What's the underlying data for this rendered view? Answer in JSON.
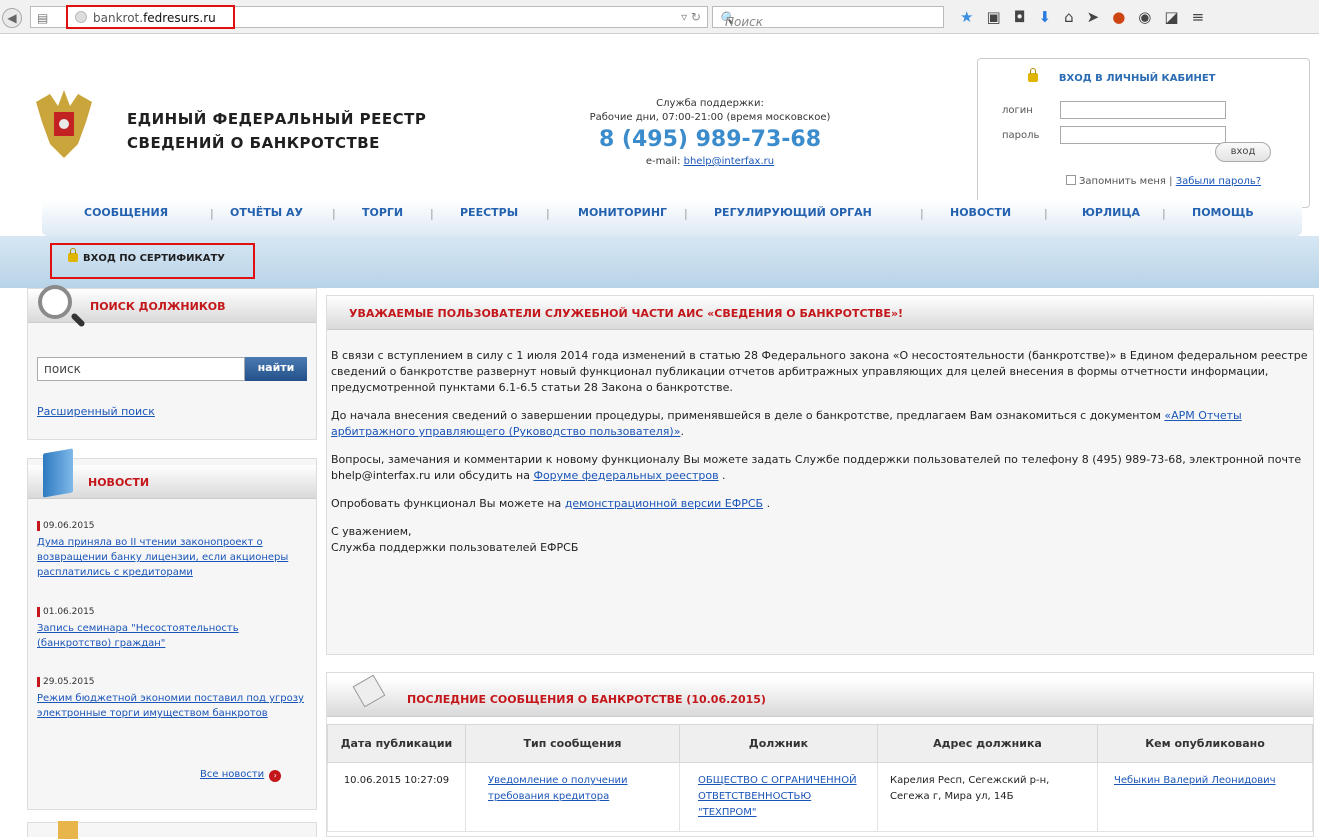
{
  "browser": {
    "url_prefix": "bankrot.",
    "url_domain": "fedresurs.ru",
    "search_placeholder": "Поиск",
    "toolbar_icons": [
      "star-icon",
      "clipboard-icon",
      "pocket-icon",
      "download-icon",
      "home-icon",
      "send-icon",
      "adblock-icon",
      "chat-icon",
      "resize-icon",
      "menu-icon"
    ]
  },
  "header": {
    "title_line1": "ЕДИНЫЙ ФЕДЕРАЛЬНЫЙ РЕЕСТР",
    "title_line2": "СВЕДЕНИЙ О БАНКРОТСТВЕ",
    "support_label": "Служба поддержки:",
    "support_hours": "Рабочие дни, 07:00-21:00 (время московское)",
    "support_phone": "8 (495) 989-73-68",
    "support_email_label": "e-mail: ",
    "support_email": "bhelp@interfax.ru"
  },
  "login": {
    "heading": "ВХОД В ЛИЧНЫЙ КАБИНЕТ",
    "login_label": "логин",
    "password_label": "пароль",
    "submit": "вход",
    "remember": "Запомнить меня",
    "separator": "|",
    "forgot": "Забыли пароль?"
  },
  "nav": [
    "СООБЩЕНИЯ",
    "ОТЧЁТЫ АУ",
    "ТОРГИ",
    "РЕЕСТРЫ",
    "МОНИТОРИНГ",
    "РЕГУЛИРУЮЩИЙ ОРГАН",
    "НОВОСТИ",
    "ЮРЛИЦА",
    "ПОМОЩЬ"
  ],
  "cert_login": "ВХОД ПО СЕРТИФИКАТУ",
  "search_panel": {
    "title": "ПОИСК ДОЛЖНИКОВ",
    "input_value": "поиск",
    "button": "найти",
    "advanced": "Расширенный поиск"
  },
  "news": {
    "title": "НОВОСТИ",
    "items": [
      {
        "date": "09.06.2015",
        "text": "Дума приняла во II чтении законопроект о возвращении банку лицензии, если акционеры расплатились с кредиторами"
      },
      {
        "date": "01.06.2015",
        "text": "Запись семинара \"Несостоятельность (банкротство) граждан\""
      },
      {
        "date": "29.05.2015",
        "text": "Режим бюджетной экономии поставил под угрозу электронные торги имуществом банкротов"
      }
    ],
    "all": "Все новости"
  },
  "notice": {
    "title": "УВАЖАЕМЫЕ ПОЛЬЗОВАТЕЛИ СЛУЖЕБНОЙ ЧАСТИ АИС «СВЕДЕНИЯ О БАНКРОТСТВЕ»!",
    "p1": "В связи с вступлением в силу с 1 июля 2014 года изменений в статью 28 Федерального закона «О несостоятельности (банкротстве)» в Едином федеральном реестре сведений о банкротстве развернут новый функционал публикации отчетов арбитражных управляющих для целей внесения в формы отчетности информации, предусмотренной пунктами 6.1-6.5 статьи 28 Закона о банкротстве.",
    "p2_text": "До начала внесения сведений о завершении процедуры, применявшейся в деле о банкротстве, предлагаем Вам ознакомиться с документом ",
    "p2_link": "«АРМ Отчеты арбитражного управляющего (Руководство пользователя)»",
    "p2_end": ".",
    "p3_text": "Вопросы, замечания и комментарии к новому функционалу Вы можете задать Службе поддержки пользователей по телефону 8 (495) 989-73-68, электронной почте bhelp@interfax.ru или обсудить на ",
    "p3_link": "Форуме федеральных реестров",
    "p3_end": " .",
    "p4_text": "Опробовать функционал Вы можете на ",
    "p4_link": "демонстрационной версии ЕФРСБ",
    "p4_end": " .",
    "sign1": "С уважением,",
    "sign2": "Служба поддержки пользователей ЕФРСБ"
  },
  "messages": {
    "title": "ПОСЛЕДНИЕ СООБЩЕНИЯ О БАНКРОТСТВЕ (10.06.2015)",
    "headers": [
      "Дата публикации",
      "Тип сообщения",
      "Должник",
      "Адрес должника",
      "Кем опубликовано"
    ],
    "rows": [
      {
        "date": "10.06.2015 10:27:09",
        "type": "Уведомление о получении требования кредитора",
        "debtor": "ОБЩЕСТВО С ОГРАНИЧЕННОЙ ОТВЕТСТВЕННОСТЬЮ \"ТЕХПРОМ\"",
        "address": "Карелия Респ, Сегежский р-н, Сегежа г, Мира ул, 14Б",
        "publisher": "Чебыкин Валерий Леонидович"
      }
    ]
  }
}
